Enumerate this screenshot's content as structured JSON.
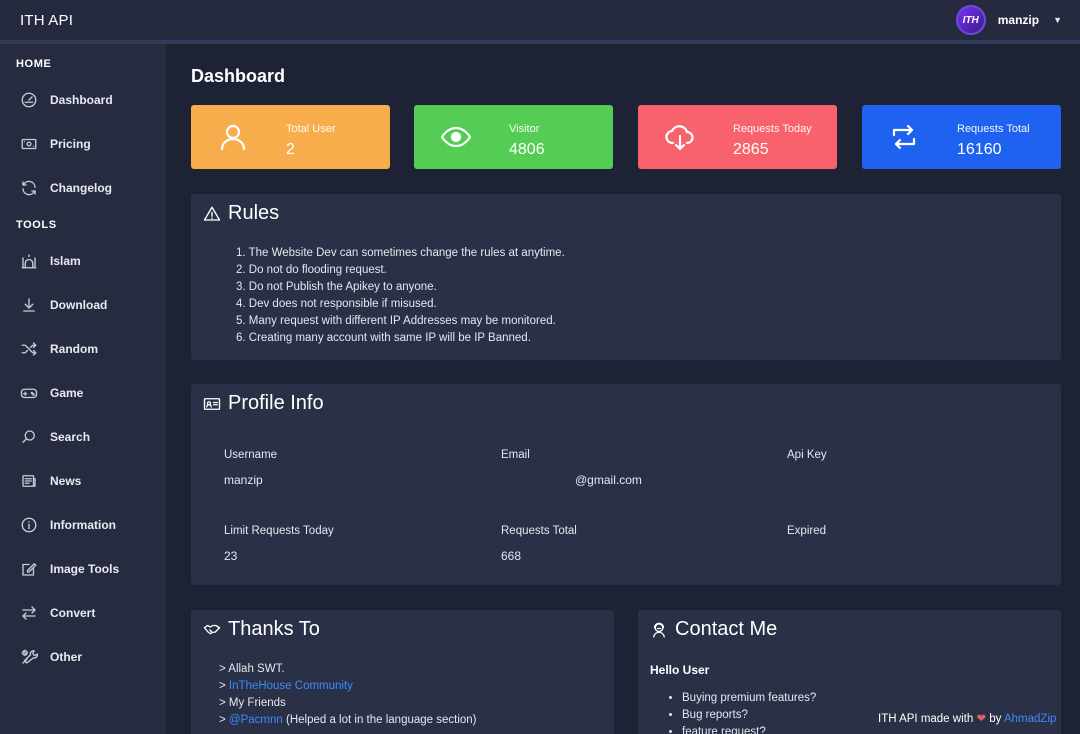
{
  "app": {
    "title": "ITH API",
    "user": {
      "avatar_text": "ITH",
      "name": "manzip",
      "menu_icon": "caret-down-icon"
    }
  },
  "sidebar": {
    "sections": [
      {
        "title": "HOME"
      },
      {
        "title": "TOOLS"
      }
    ],
    "items": [
      {
        "label": "Dashboard",
        "icon": "speedometer-icon"
      },
      {
        "label": "Pricing",
        "icon": "money-icon"
      },
      {
        "label": "Changelog",
        "icon": "refresh-icon"
      },
      {
        "label": "Islam",
        "icon": "mosque-icon"
      },
      {
        "label": "Download",
        "icon": "download-icon"
      },
      {
        "label": "Random",
        "icon": "shuffle-icon"
      },
      {
        "label": "Game",
        "icon": "gamepad-icon"
      },
      {
        "label": "Search",
        "icon": "search-icon"
      },
      {
        "label": "News",
        "icon": "newspaper-icon"
      },
      {
        "label": "Information",
        "icon": "info-icon"
      },
      {
        "label": "Image Tools",
        "icon": "edit-icon"
      },
      {
        "label": "Convert",
        "icon": "arrows-exchange-icon"
      },
      {
        "label": "Other",
        "icon": "tools-icon"
      }
    ]
  },
  "main": {
    "title": "Dashboard",
    "stats": [
      {
        "label": "Total User",
        "value": "2",
        "color": "#f7ad4b",
        "icon": "user-icon"
      },
      {
        "label": "Visitor",
        "value": "4806",
        "color": "#55cd55",
        "icon": "eye-icon"
      },
      {
        "label": "Requests Today",
        "value": "2865",
        "color": "#f8626c",
        "icon": "cloud-download-icon"
      },
      {
        "label": "Requests Total",
        "value": "16160",
        "color": "#1f62f0",
        "icon": "repeat-icon"
      }
    ],
    "rules": {
      "title": "Rules",
      "items": [
        "1. The Website Dev can sometimes change the rules at anytime.",
        "2. Do not do flooding request.",
        "3. Do not Publish the Apikey to anyone.",
        "4. Dev does not responsible if misused.",
        "5. Many request with different IP Addresses may be monitored.",
        "6. Creating many account with same IP will be IP Banned."
      ]
    },
    "profile": {
      "title": "Profile Info",
      "username_label": "Username",
      "username": "manzip",
      "email_label": "Email",
      "email": "@gmail.com",
      "apikey_label": "Api Key",
      "limit_label": "Limit Requests Today",
      "limit": "23",
      "total_label": "Requests Total",
      "total": "668",
      "expired_label": "Expired"
    },
    "thanks": {
      "title": "Thanks To",
      "line1": "> Allah SWT.",
      "line2_prefix": "> ",
      "line2_link": "InTheHouse Community",
      "line3": "> My Friends",
      "line4_prefix": "> ",
      "line4_link": "@Pacmnn",
      "line4_suffix": " (Helped a lot in the language section)"
    },
    "contact": {
      "title": "Contact Me",
      "greeting": "Hello User",
      "items": [
        "Buying premium features?",
        "Bug reports?",
        "feature request?"
      ]
    }
  },
  "footer": {
    "text_before": "ITH API made with ",
    "text_by": " by ",
    "author": "AhmadZip"
  }
}
